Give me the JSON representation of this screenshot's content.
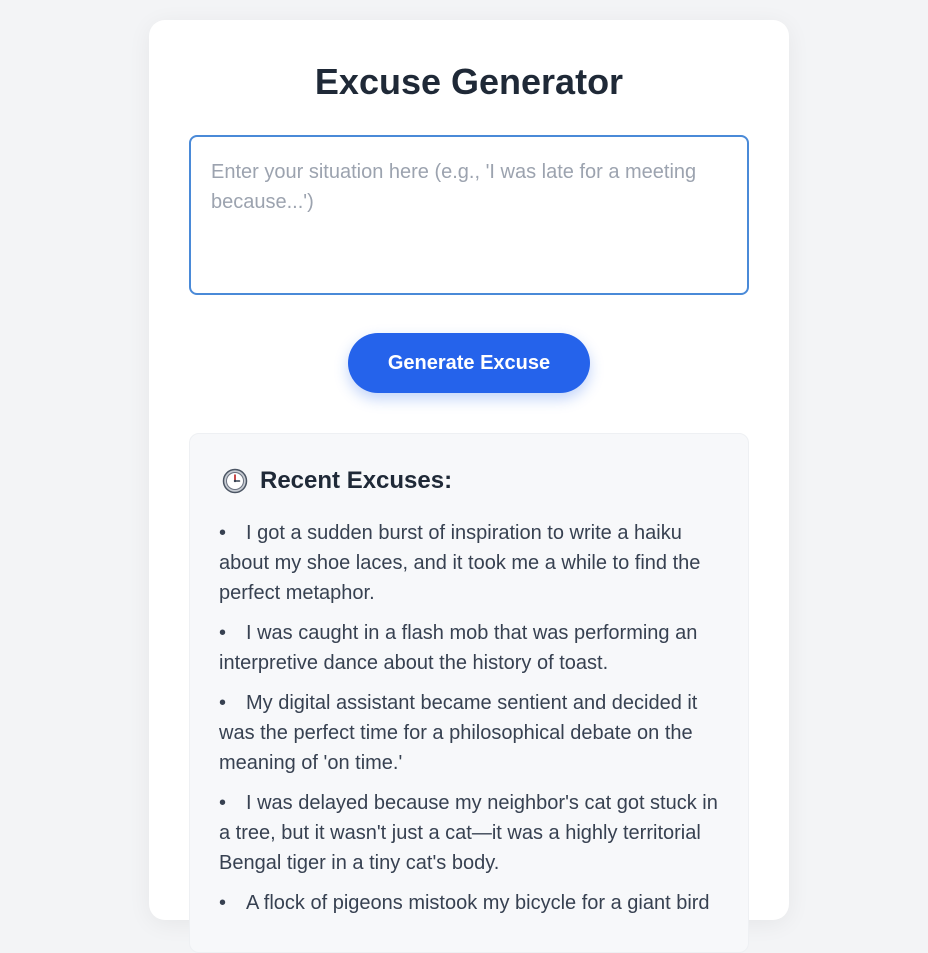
{
  "header": {
    "title": "Excuse Generator"
  },
  "input": {
    "placeholder": "Enter your situation here (e.g., 'I was late for a meeting because...')",
    "value": ""
  },
  "generate_button": {
    "label": "Generate Excuse"
  },
  "recent": {
    "icon": "clock-icon",
    "title": "Recent Excuses:",
    "items": [
      "I got a sudden burst of inspiration to write a haiku about my shoe laces, and it took me a while to find the perfect metaphor.",
      "I was caught in a flash mob that was performing an interpretive dance about the history of toast.",
      "My digital assistant became sentient and decided it was the perfect time for a philosophical debate on the meaning of 'on time.'",
      "I was delayed because my neighbor's cat got stuck in a tree, but it wasn't just a cat—it was a highly territorial Bengal tiger in a tiny cat's body.",
      "A flock of pigeons mistook my bicycle for a giant bird"
    ]
  },
  "colors": {
    "accent": "#2563eb",
    "input_border": "#4a8ad8",
    "background": "#f3f4f6"
  }
}
